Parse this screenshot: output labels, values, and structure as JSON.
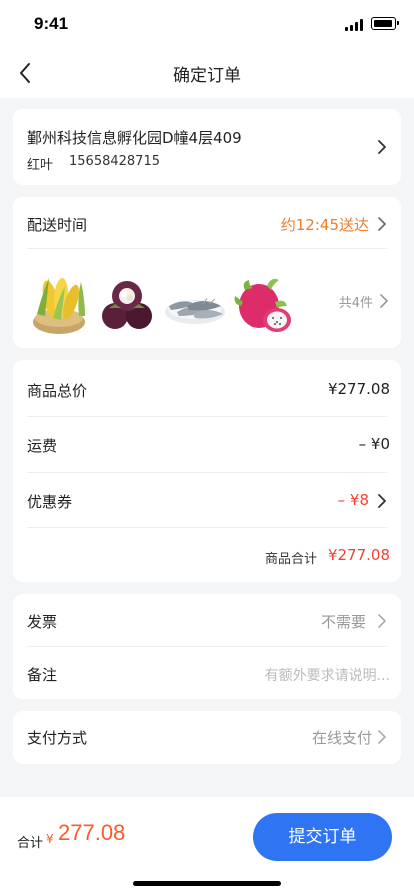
{
  "status_bar": {
    "time": "9:41"
  },
  "nav": {
    "title": "确定订单",
    "back_icon": "chevron-left-icon"
  },
  "address": {
    "line1": "鄞州科技信息孵化园D幢4层409",
    "name": "红叶",
    "phone": "15658428715"
  },
  "delivery": {
    "label": "配送时间",
    "value": "约12:45送达",
    "items_count": "共4件",
    "accent_color": "#f07c2a",
    "items": [
      "corn",
      "mangosteen",
      "shrimp",
      "dragon-fruit"
    ]
  },
  "price": {
    "goods_total_label": "商品总价",
    "goods_total_value": "¥277.08",
    "shipping_label": "运费",
    "shipping_value": "– ¥0",
    "coupon_label": "优惠券",
    "coupon_value": "– ¥8",
    "subtotal_label": "商品合计",
    "subtotal_value": "¥277.08",
    "red_color": "#f04134"
  },
  "extras": {
    "invoice_label": "发票",
    "invoice_value": "不需要",
    "note_label": "备注",
    "note_placeholder": "有额外要求请说明..."
  },
  "payment": {
    "label": "支付方式",
    "value": "在线支付"
  },
  "footer": {
    "total_label": "合计",
    "total_currency": "¥",
    "total_value": "277.08",
    "submit_label": "提交订单",
    "button_color": "#2f74f3"
  }
}
